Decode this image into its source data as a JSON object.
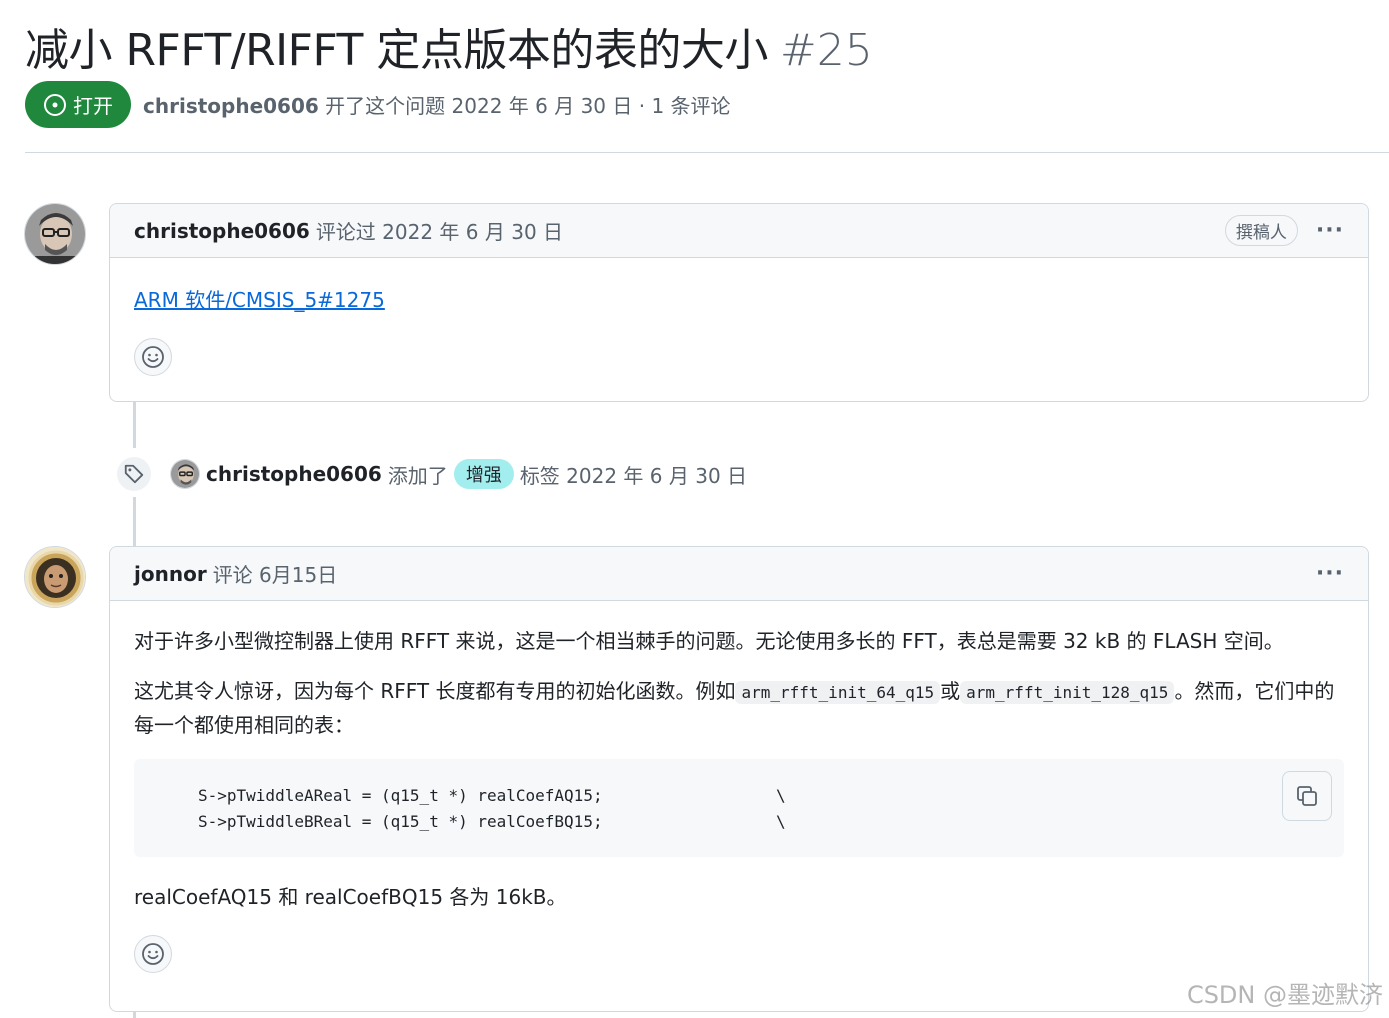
{
  "issue": {
    "title": "减小 RFFT/RIFFT 定点版本的表的大小",
    "number": "#25",
    "state_label": "打开",
    "opened_by": "christophe0606",
    "meta_rest": "开了这个问题 2022 年 6 月 30 日 · 1 条评论"
  },
  "comments": [
    {
      "author": "christophe0606",
      "action": "评论过 2022 年 6 月 30 日",
      "role": "撰稿人",
      "more": "···",
      "link_text": "ARM 软件/CMSIS_5#1275"
    },
    {
      "author": "jonnor",
      "action": "评论 6月15日",
      "more": "···",
      "para1": "对于许多小型微控制器上使用 RFFT 来说，这是一个相当棘手的问题。无论使用多长的 FFT，表总是需要 32 kB 的 FLASH 空间。",
      "para2_a": "这尤其令人惊讶，因为每个 RFFT 长度都有专用的初始化函数。例如",
      "para2_code1": "arm_rfft_init_64_q15",
      "para2_b": "或",
      "para2_code2": "arm_rfft_init_128_q15",
      "para2_c": "。然而，它们中的每一个都使用相同的表：",
      "code_line1": "S->pTwiddleAReal = (q15_t *) realCoefAQ15;                  \\",
      "code_line2": "S->pTwiddleBReal = (q15_t *) realCoefBQ15;                  \\",
      "para3": "realCoefAQ15 和 realCoefBQ15 各为 16kB。"
    }
  ],
  "event": {
    "author": "christophe0606",
    "action": "添加了",
    "label": "增强",
    "suffix": "标签 2022 年 6 月 30 日"
  },
  "watermark": "CSDN @墨迹默济",
  "colors": {
    "open_green": "#1f883d",
    "link_blue": "#0969da",
    "label_bg": "#a2eeef"
  },
  "icons": [
    "issue-open-icon",
    "smiley-icon",
    "tag-icon",
    "copy-icon",
    "kebab-icon"
  ]
}
